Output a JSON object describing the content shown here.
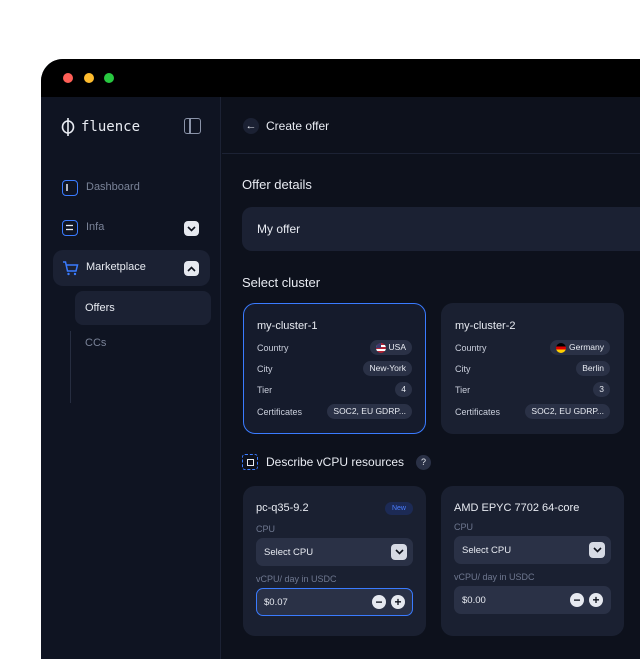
{
  "colors": {
    "accent": "#3a7bff",
    "background": "#0d111c",
    "card": "#1a2031",
    "traffic_red": "#ff5f57",
    "traffic_yellow": "#febc2e",
    "traffic_green": "#28c840"
  },
  "sidebar": {
    "brand": "fluence",
    "items": [
      {
        "label": "Dashboard",
        "icon": "dashboard-icon"
      },
      {
        "label": "Infa",
        "icon": "infra-icon"
      },
      {
        "label": "Marketplace",
        "icon": "cart-icon"
      }
    ],
    "sub_items": [
      {
        "label": "Offers"
      },
      {
        "label": "CCs"
      }
    ]
  },
  "header": {
    "title": "Create offer"
  },
  "offer_details": {
    "heading": "Offer details",
    "name_value": "My offer"
  },
  "clusters": {
    "heading": "Select cluster",
    "row_labels": {
      "country": "Country",
      "city": "City",
      "tier": "Tier",
      "certificates": "Certificates"
    },
    "items": [
      {
        "name": "my-cluster-1",
        "country": "USA",
        "flag": "us-flag-icon",
        "city": "New-York",
        "tier": "4",
        "certificates": "SOC2, EU GDRP...",
        "selected": true
      },
      {
        "name": "my-cluster-2",
        "country": "Germany",
        "flag": "germany-flag-icon",
        "city": "Berlin",
        "tier": "3",
        "certificates": "SOC2, EU GDRP...",
        "selected": false
      }
    ]
  },
  "vcpu": {
    "heading": "Describe vCPU resources",
    "help": "?",
    "cpu_label": "CPU",
    "price_label": "vCPU/ day in USDC",
    "items": [
      {
        "name": "pc-q35-9.2",
        "badge": "New",
        "cpu_value": "Select CPU",
        "price": "$0.07"
      },
      {
        "name": "AMD EPYC 7702 64-core",
        "cpu_value": "Select CPU",
        "price": "$0.00"
      }
    ]
  }
}
